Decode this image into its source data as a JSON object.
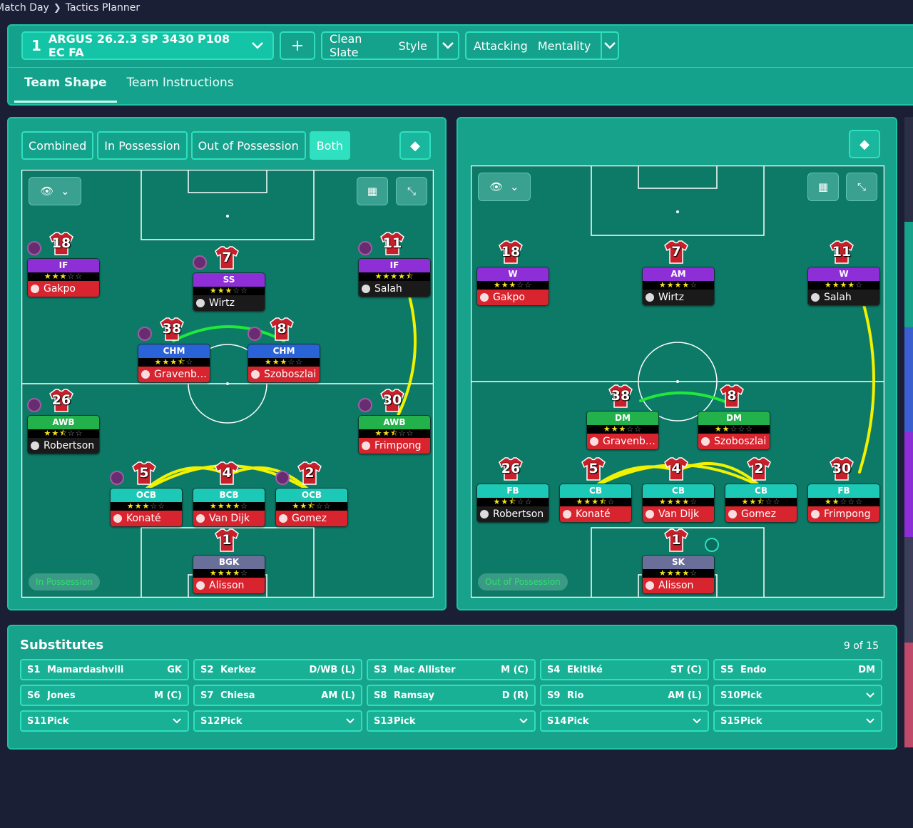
{
  "breadcrumb": {
    "parent": "Match Day",
    "current": "Tactics Planner"
  },
  "toolbar": {
    "tactic_number": "1",
    "tactic_name": "ARGUS 26.2.3 SP 3430 P108 EC FA",
    "add_label": "+",
    "style_value": "Clean Slate",
    "style_label": "Style",
    "mentality_value": "Attacking",
    "mentality_label": "Mentality"
  },
  "tabs": [
    "Team Shape",
    "Team Instructions"
  ],
  "view_modes": [
    "Combined",
    "In Possession",
    "Out of Possession",
    "Both"
  ],
  "active_view_mode": "Both",
  "pitches": {
    "left": {
      "phase": "In Possession",
      "players": [
        {
          "num": "18",
          "role": "IF",
          "stars": 3,
          "name": "Gakpo",
          "pos_color": "purple",
          "name_color": "red",
          "icon": true
        },
        {
          "num": "7",
          "role": "SS",
          "stars": 3,
          "name": "Wirtz",
          "pos_color": "purple",
          "name_color": "black",
          "icon": true
        },
        {
          "num": "11",
          "role": "IF",
          "stars": 4.5,
          "name": "Salah",
          "pos_color": "purple",
          "name_color": "black",
          "icon": true
        },
        {
          "num": "38",
          "role": "CHM",
          "stars": 3.5,
          "name": "Gravenber...",
          "pos_color": "blue",
          "name_color": "red",
          "icon": true
        },
        {
          "num": "8",
          "role": "CHM",
          "stars": 3,
          "name": "Szoboszlai",
          "pos_color": "blue",
          "name_color": "red",
          "icon": true
        },
        {
          "num": "26",
          "role": "AWB",
          "stars": 2.5,
          "name": "Robertson",
          "pos_color": "green",
          "name_color": "black",
          "icon": true
        },
        {
          "num": "30",
          "role": "AWB",
          "stars": 2.5,
          "name": "Frimpong",
          "pos_color": "green",
          "name_color": "red",
          "icon": true
        },
        {
          "num": "5",
          "role": "OCB",
          "stars": 3,
          "name": "Konaté",
          "pos_color": "teal",
          "name_color": "red",
          "icon": true
        },
        {
          "num": "4",
          "role": "BCB",
          "stars": 4,
          "name": "Van Dijk",
          "pos_color": "teal",
          "name_color": "red",
          "icon": false
        },
        {
          "num": "2",
          "role": "OCB",
          "stars": 2.5,
          "name": "Gomez",
          "pos_color": "teal",
          "name_color": "red",
          "icon": true
        },
        {
          "num": "1",
          "role": "BGK",
          "stars": 4,
          "name": "Alisson",
          "pos_color": "slate",
          "name_color": "red",
          "icon": false
        }
      ]
    },
    "right": {
      "phase": "Out of Possession",
      "players": [
        {
          "num": "18",
          "role": "W",
          "stars": 3,
          "name": "Gakpo",
          "pos_color": "purple",
          "name_color": "red"
        },
        {
          "num": "7",
          "role": "AM",
          "stars": 4,
          "name": "Wirtz",
          "pos_color": "purple",
          "name_color": "black"
        },
        {
          "num": "11",
          "role": "W",
          "stars": 4,
          "name": "Salah",
          "pos_color": "purple",
          "name_color": "black"
        },
        {
          "num": "38",
          "role": "DM",
          "stars": 3,
          "name": "Gravenber...",
          "pos_color": "green",
          "name_color": "red"
        },
        {
          "num": "8",
          "role": "DM",
          "stars": 2,
          "name": "Szoboszlai",
          "pos_color": "green",
          "name_color": "red"
        },
        {
          "num": "26",
          "role": "FB",
          "stars": 2.5,
          "name": "Robertson",
          "pos_color": "teal",
          "name_color": "black"
        },
        {
          "num": "5",
          "role": "CB",
          "stars": 3.5,
          "name": "Konaté",
          "pos_color": "teal",
          "name_color": "red"
        },
        {
          "num": "4",
          "role": "CB",
          "stars": 4,
          "name": "Van Dijk",
          "pos_color": "teal",
          "name_color": "red"
        },
        {
          "num": "2",
          "role": "CB",
          "stars": 2.5,
          "name": "Gomez",
          "pos_color": "teal",
          "name_color": "red"
        },
        {
          "num": "30",
          "role": "FB",
          "stars": 2,
          "name": "Frimpong",
          "pos_color": "teal",
          "name_color": "red"
        },
        {
          "num": "1",
          "role": "SK",
          "stars": 4,
          "name": "Alisson",
          "pos_color": "slate",
          "name_color": "red"
        }
      ]
    }
  },
  "substitutes": {
    "title": "Substitutes",
    "count": "9 of 15",
    "slots": [
      {
        "slot": "S1",
        "name": "Mamardashvili",
        "pos": "GK"
      },
      {
        "slot": "S2",
        "name": "Kerkez",
        "pos": "D/WB (L)"
      },
      {
        "slot": "S3",
        "name": "Mac Allister",
        "pos": "M (C)"
      },
      {
        "slot": "S4",
        "name": "Ekitiké",
        "pos": "ST (C)"
      },
      {
        "slot": "S5",
        "name": "Endo",
        "pos": "DM"
      },
      {
        "slot": "S6",
        "name": "Jones",
        "pos": "M (C)"
      },
      {
        "slot": "S7",
        "name": "Chiesa",
        "pos": "AM (L)"
      },
      {
        "slot": "S8",
        "name": "Ramsay",
        "pos": "D (R)"
      },
      {
        "slot": "S9",
        "name": "Rio",
        "pos": "AM (L)"
      },
      {
        "slot": "S10",
        "name": "Pick",
        "pos": ""
      },
      {
        "slot": "S11",
        "name": "Pick",
        "pos": ""
      },
      {
        "slot": "S12",
        "name": "Pick",
        "pos": ""
      },
      {
        "slot": "S13",
        "name": "Pick",
        "pos": ""
      },
      {
        "slot": "S14",
        "name": "Pick",
        "pos": ""
      },
      {
        "slot": "S15",
        "name": "Pick",
        "pos": ""
      }
    ]
  },
  "colors": {
    "panel": "#16a28b",
    "pitch": "#0d7a67",
    "accent_border": "#2ee0bd",
    "link_yellow": "#f2f200",
    "link_green": "#22e83a"
  }
}
